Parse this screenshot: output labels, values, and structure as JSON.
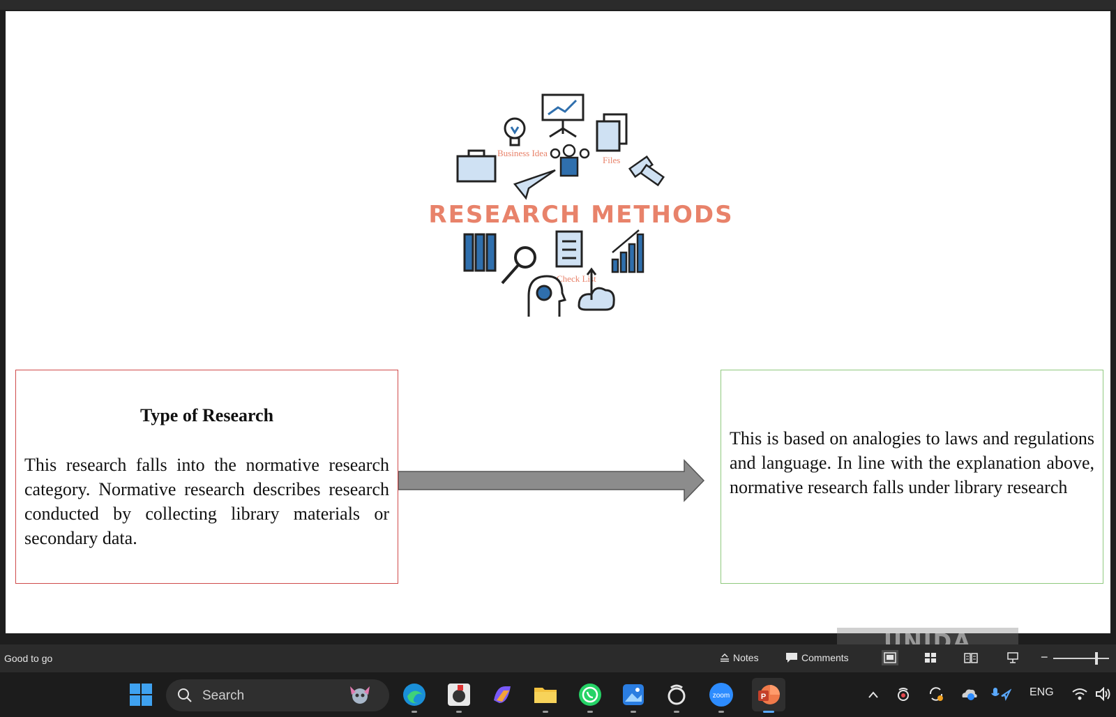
{
  "slide": {
    "hero_title": "RESEARCH METHODS",
    "hero_labels": {
      "business_idea": "Business Idea",
      "files": "Files",
      "check_list": "Check List"
    },
    "left_box": {
      "heading": "Type of Research",
      "text": "This research falls into the normative research category. Normative research describes research conducted by collecting library materials or secondary data."
    },
    "right_box": {
      "text": "This is based on analogies to laws and regulations and language. In line with the explanation above, normative research falls under library research"
    },
    "colors": {
      "hero_title": "#e8826a",
      "left_border": "#cf4a4a",
      "right_border": "#8fc97e",
      "arrow": "#8c8c8c",
      "icon_blue": "#2f6fad"
    }
  },
  "statusbar": {
    "status": "Good to go",
    "notes_label": "Notes",
    "comments_label": "Comments"
  },
  "watermark": "UNIDA GONTOR",
  "taskbar": {
    "search_placeholder": "Search",
    "apps": [
      "windows-start",
      "edge",
      "media-app",
      "copilot",
      "file-explorer",
      "whatsapp",
      "photos",
      "circle-app",
      "zoom",
      "powerpoint"
    ],
    "zoom_label": "zoom",
    "tray_language": "ENG"
  }
}
